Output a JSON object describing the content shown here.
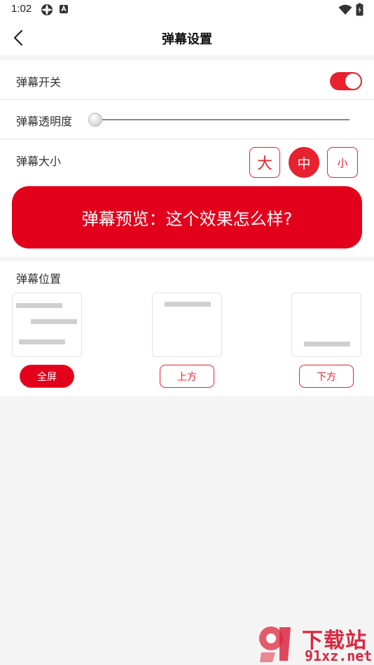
{
  "status_bar": {
    "time": "1:02"
  },
  "header": {
    "title": "弹幕设置"
  },
  "danmaku_switch": {
    "label": "弹幕开关",
    "on": true
  },
  "opacity": {
    "label": "弹幕透明度",
    "value": 0
  },
  "size": {
    "label": "弹幕大小",
    "options": [
      "大",
      "中",
      "小"
    ],
    "selected": "中"
  },
  "preview": {
    "text": "弹幕预览：这个效果怎么样?"
  },
  "position": {
    "label": "弹幕位置",
    "options": [
      "全屏",
      "上方",
      "下方"
    ],
    "selected": "全屏"
  },
  "watermark": {
    "title": "下载站",
    "domain": "91xz.net"
  },
  "colors": {
    "accent": "#e8212f",
    "preview_bg": "#e3001b",
    "page_bg": "#f4f4f4"
  }
}
